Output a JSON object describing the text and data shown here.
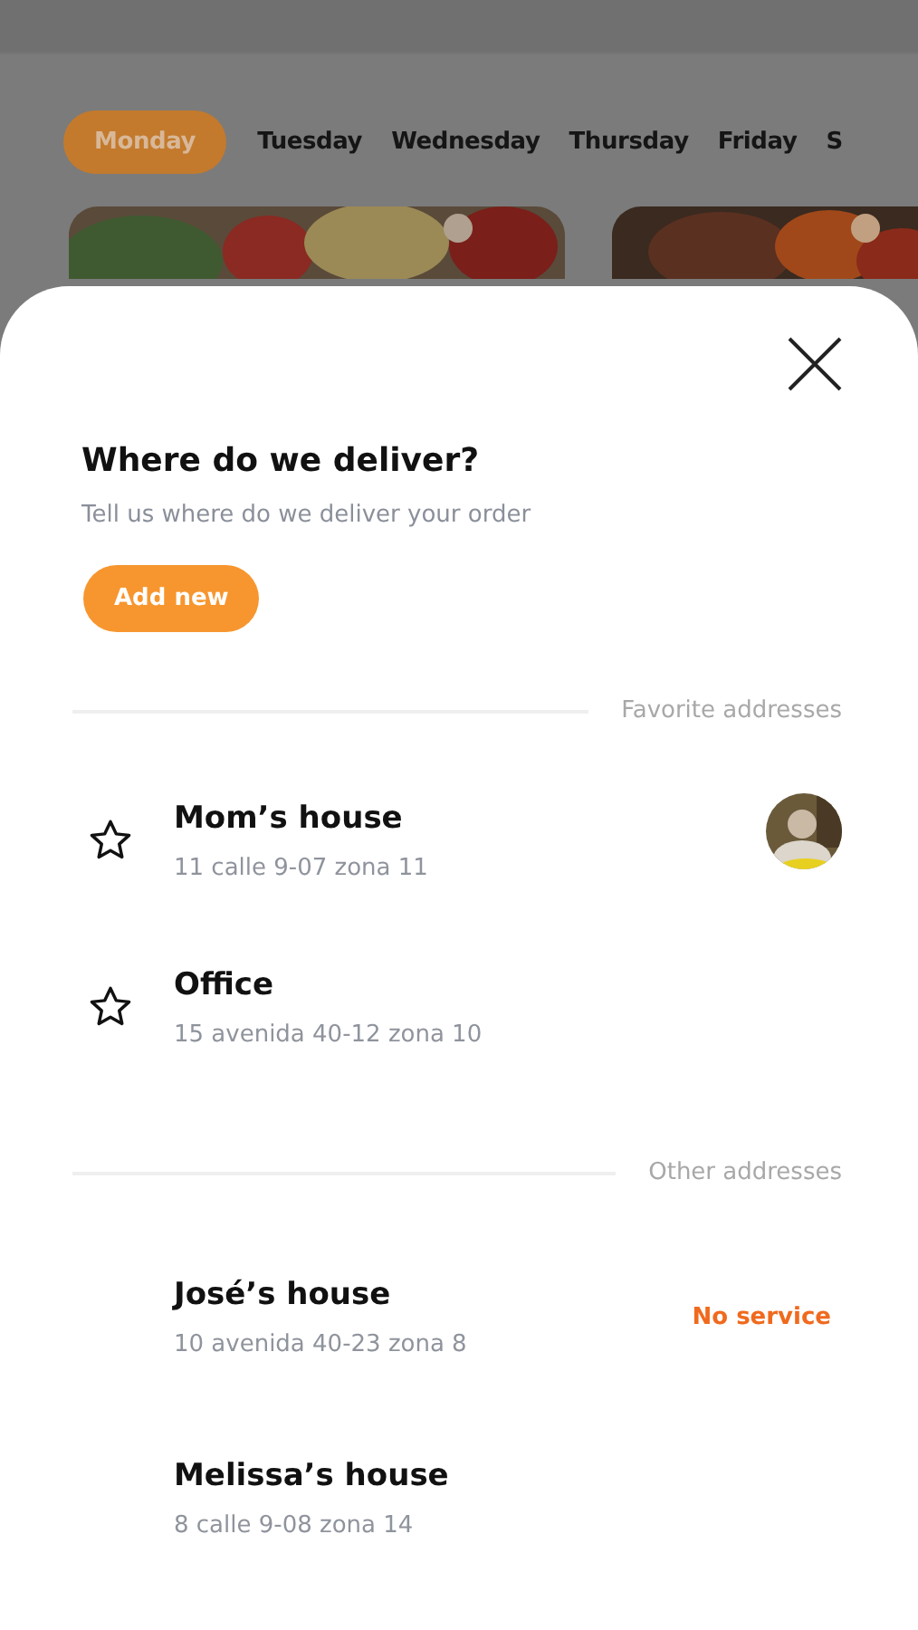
{
  "days": [
    {
      "label": "Monday",
      "selected": true
    },
    {
      "label": "Tuesday",
      "selected": false
    },
    {
      "label": "Wednesday",
      "selected": false
    },
    {
      "label": "Thursday",
      "selected": false
    },
    {
      "label": "Friday",
      "selected": false
    },
    {
      "label": "S",
      "selected": false
    }
  ],
  "sheet": {
    "title": "Where do we deliver?",
    "subtitle": "Tell us where do we deliver your order",
    "add_button": "Add new",
    "sections": [
      {
        "label": "Favorite addresses",
        "items": [
          {
            "name": "Mom’s house",
            "address": "11 calle 9-07 zona 11",
            "favorite": true
          },
          {
            "name": "Office",
            "address": "15 avenida 40-12 zona 10",
            "favorite": true
          }
        ]
      },
      {
        "label": "Other addresses",
        "items": [
          {
            "name": "José’s house",
            "address": "10 avenida 40-23 zona 8",
            "favorite": false,
            "status": "No service"
          },
          {
            "name": "Melissa’s house",
            "address": "8 calle 9-08 zona 14",
            "favorite": false
          }
        ]
      }
    ]
  }
}
